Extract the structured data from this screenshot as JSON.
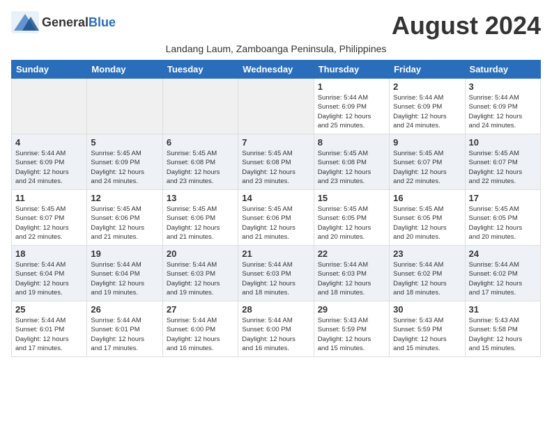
{
  "header": {
    "logo_general": "General",
    "logo_blue": "Blue",
    "month_title": "August 2024",
    "subtitle": "Landang Laum, Zamboanga Peninsula, Philippines"
  },
  "days_of_week": [
    "Sunday",
    "Monday",
    "Tuesday",
    "Wednesday",
    "Thursday",
    "Friday",
    "Saturday"
  ],
  "weeks": [
    [
      {
        "day": "",
        "info": ""
      },
      {
        "day": "",
        "info": ""
      },
      {
        "day": "",
        "info": ""
      },
      {
        "day": "",
        "info": ""
      },
      {
        "day": "1",
        "info": "Sunrise: 5:44 AM\nSunset: 6:09 PM\nDaylight: 12 hours\nand 25 minutes."
      },
      {
        "day": "2",
        "info": "Sunrise: 5:44 AM\nSunset: 6:09 PM\nDaylight: 12 hours\nand 24 minutes."
      },
      {
        "day": "3",
        "info": "Sunrise: 5:44 AM\nSunset: 6:09 PM\nDaylight: 12 hours\nand 24 minutes."
      }
    ],
    [
      {
        "day": "4",
        "info": "Sunrise: 5:44 AM\nSunset: 6:09 PM\nDaylight: 12 hours\nand 24 minutes."
      },
      {
        "day": "5",
        "info": "Sunrise: 5:45 AM\nSunset: 6:09 PM\nDaylight: 12 hours\nand 24 minutes."
      },
      {
        "day": "6",
        "info": "Sunrise: 5:45 AM\nSunset: 6:08 PM\nDaylight: 12 hours\nand 23 minutes."
      },
      {
        "day": "7",
        "info": "Sunrise: 5:45 AM\nSunset: 6:08 PM\nDaylight: 12 hours\nand 23 minutes."
      },
      {
        "day": "8",
        "info": "Sunrise: 5:45 AM\nSunset: 6:08 PM\nDaylight: 12 hours\nand 23 minutes."
      },
      {
        "day": "9",
        "info": "Sunrise: 5:45 AM\nSunset: 6:07 PM\nDaylight: 12 hours\nand 22 minutes."
      },
      {
        "day": "10",
        "info": "Sunrise: 5:45 AM\nSunset: 6:07 PM\nDaylight: 12 hours\nand 22 minutes."
      }
    ],
    [
      {
        "day": "11",
        "info": "Sunrise: 5:45 AM\nSunset: 6:07 PM\nDaylight: 12 hours\nand 22 minutes."
      },
      {
        "day": "12",
        "info": "Sunrise: 5:45 AM\nSunset: 6:06 PM\nDaylight: 12 hours\nand 21 minutes."
      },
      {
        "day": "13",
        "info": "Sunrise: 5:45 AM\nSunset: 6:06 PM\nDaylight: 12 hours\nand 21 minutes."
      },
      {
        "day": "14",
        "info": "Sunrise: 5:45 AM\nSunset: 6:06 PM\nDaylight: 12 hours\nand 21 minutes."
      },
      {
        "day": "15",
        "info": "Sunrise: 5:45 AM\nSunset: 6:05 PM\nDaylight: 12 hours\nand 20 minutes."
      },
      {
        "day": "16",
        "info": "Sunrise: 5:45 AM\nSunset: 6:05 PM\nDaylight: 12 hours\nand 20 minutes."
      },
      {
        "day": "17",
        "info": "Sunrise: 5:45 AM\nSunset: 6:05 PM\nDaylight: 12 hours\nand 20 minutes."
      }
    ],
    [
      {
        "day": "18",
        "info": "Sunrise: 5:44 AM\nSunset: 6:04 PM\nDaylight: 12 hours\nand 19 minutes."
      },
      {
        "day": "19",
        "info": "Sunrise: 5:44 AM\nSunset: 6:04 PM\nDaylight: 12 hours\nand 19 minutes."
      },
      {
        "day": "20",
        "info": "Sunrise: 5:44 AM\nSunset: 6:03 PM\nDaylight: 12 hours\nand 19 minutes."
      },
      {
        "day": "21",
        "info": "Sunrise: 5:44 AM\nSunset: 6:03 PM\nDaylight: 12 hours\nand 18 minutes."
      },
      {
        "day": "22",
        "info": "Sunrise: 5:44 AM\nSunset: 6:03 PM\nDaylight: 12 hours\nand 18 minutes."
      },
      {
        "day": "23",
        "info": "Sunrise: 5:44 AM\nSunset: 6:02 PM\nDaylight: 12 hours\nand 18 minutes."
      },
      {
        "day": "24",
        "info": "Sunrise: 5:44 AM\nSunset: 6:02 PM\nDaylight: 12 hours\nand 17 minutes."
      }
    ],
    [
      {
        "day": "25",
        "info": "Sunrise: 5:44 AM\nSunset: 6:01 PM\nDaylight: 12 hours\nand 17 minutes."
      },
      {
        "day": "26",
        "info": "Sunrise: 5:44 AM\nSunset: 6:01 PM\nDaylight: 12 hours\nand 17 minutes."
      },
      {
        "day": "27",
        "info": "Sunrise: 5:44 AM\nSunset: 6:00 PM\nDaylight: 12 hours\nand 16 minutes."
      },
      {
        "day": "28",
        "info": "Sunrise: 5:44 AM\nSunset: 6:00 PM\nDaylight: 12 hours\nand 16 minutes."
      },
      {
        "day": "29",
        "info": "Sunrise: 5:43 AM\nSunset: 5:59 PM\nDaylight: 12 hours\nand 15 minutes."
      },
      {
        "day": "30",
        "info": "Sunrise: 5:43 AM\nSunset: 5:59 PM\nDaylight: 12 hours\nand 15 minutes."
      },
      {
        "day": "31",
        "info": "Sunrise: 5:43 AM\nSunset: 5:58 PM\nDaylight: 12 hours\nand 15 minutes."
      }
    ]
  ]
}
